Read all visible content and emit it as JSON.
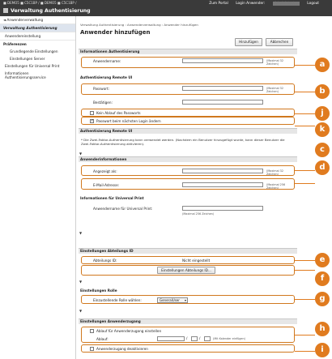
{
  "topbar": {
    "left_text": "■ DEMO5 ■ C5C1BP / ■ DEMO5 ■ C5C1BP /",
    "title": "Verwaltung Authentisierung",
    "zum_portal": "Zum Portal",
    "login_anwender": "Login Anwender:",
    "redacted_user": "Administrator",
    "logout": "Logout"
  },
  "sidebar": {
    "items": [
      {
        "label": "◄ Anwenderverwaltung"
      },
      {
        "label": "Verwaltung Authentisierung"
      },
      {
        "label": "Anwendereinstellung"
      },
      {
        "label": "Präferenzen"
      },
      {
        "label": "Grundlegende Einstellungen"
      },
      {
        "label": "Einstellungen Server"
      },
      {
        "label": "Einstellungen für Universal Print"
      },
      {
        "label": "Informationen Authentisierungsservice"
      }
    ]
  },
  "main": {
    "breadcrumb": "Verwaltung Authentisierung : Anwenderverwaltung : Anwender hinzufügen",
    "title": "Anwender hinzufügen",
    "add_button": "Hinzufügen",
    "cancel_button": "Abbrechen",
    "sections": {
      "info_auth": "Informationen Authentisierung",
      "remote_ui_auth": "Authentisierung Remote UI",
      "remote_ui_auth2": "Authentisierung Remote UI",
      "anwenderinfo": "Anwenderinformationen",
      "universal_print": "Informationen für Universal Print",
      "abteilung": "Einstellungen Abteilungs ID",
      "rolle": "Einstellungen Rolle",
      "anwenderzugang": "Einstellungen Anwenderzugang"
    },
    "username_label": "Anwendername:",
    "username_hint": "(Maximal 32 Zeichen)",
    "password_label": "Passwort:",
    "password_hint": "(Maximal 32 Zeichen)",
    "confirm_label": "Bestätigen:",
    "cb_no_expire": "Kein Ablauf des Passworts",
    "cb_change_pw": "Passwort beim nächsten Login ändern",
    "note": "* Die Zwei-Faktor-Authentisierung kann verwendet werden. (Nachdem ein Benutzer hinzugefügt wurde, kann dieser Benutzer die Zwei-Faktor-Authentisierung aktivieren).",
    "displayed_as_label": "Angezeigt als:",
    "displayed_as_hint": "(Maximal 32 Zeichen)",
    "email_label": "E-Mail-Adresse:",
    "email_hint": "(Maximal 256 Zeichen)",
    "up_username_label": "Anwendername für Universal Print:",
    "up_username_hint": "(Maximal 256 Zeichen)",
    "dept_id_label": "Abteilungs ID:",
    "dept_id_value": "Nicht eingestellt",
    "dept_button": "Einstellungen Abteilungs ID...",
    "role_label": "Einzustellende Rolle wählen:",
    "role_value": "GeneralUser",
    "cb_access_expire": "Ablauf für Anwenderzugang einstellen",
    "ablauf_label": "Ablauf:",
    "ablauf_hint": "(Mit Kalender einfügen)",
    "cb_disable_access": "Anwenderzugang deaktivieren",
    "collapse_marker": "▼"
  },
  "callouts": [
    "a",
    "b",
    "j",
    "k",
    "c",
    "d",
    "e",
    "f",
    "g",
    "h",
    "i"
  ],
  "colors": {
    "accent": "#e07b1f",
    "topbar": "#3a3a3a",
    "section": "#e6e6e6"
  }
}
